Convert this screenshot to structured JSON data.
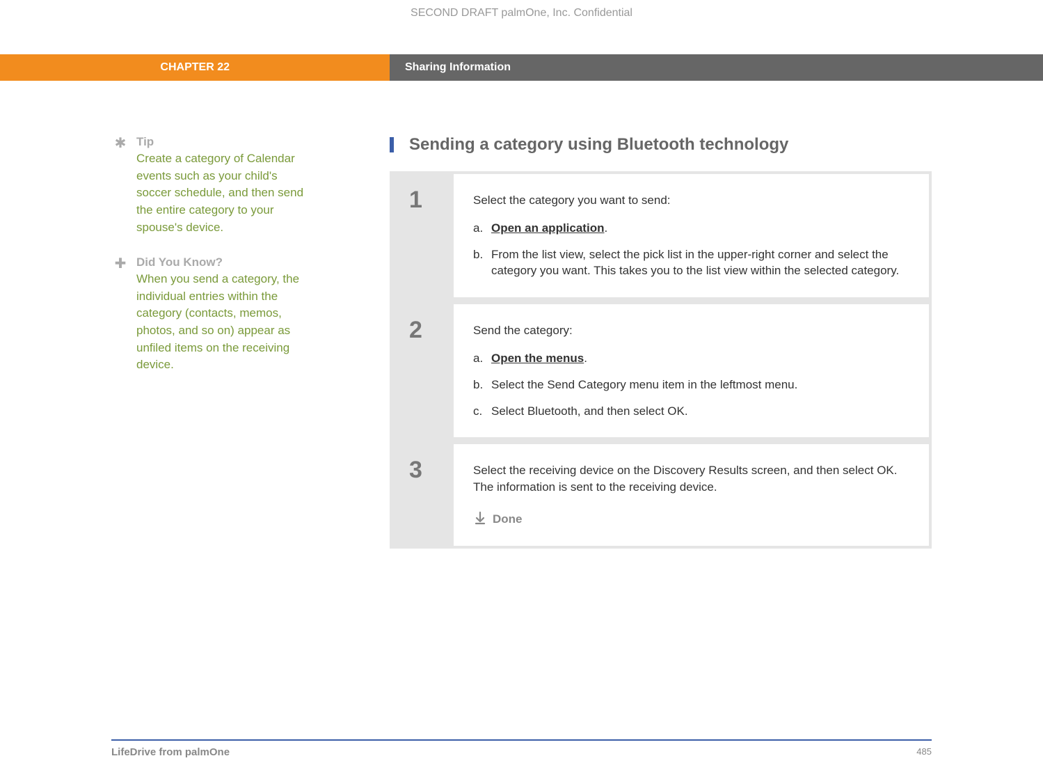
{
  "draft_header": "SECOND DRAFT palmOne, Inc.  Confidential",
  "chapter_label": "CHAPTER 22",
  "chapter_title": "Sharing Information",
  "sidebar": {
    "tip": {
      "heading": "Tip",
      "text": "Create a category of Calendar events such as your child's soccer schedule, and then send the entire category to your spouse's device."
    },
    "dyk": {
      "heading": "Did You Know?",
      "text": "When you send a category, the individual entries within the category (contacts, memos, photos, and so on) appear as unfiled items on the receiving device."
    }
  },
  "section_heading": "Sending a category using Bluetooth technology",
  "steps": [
    {
      "number": "1",
      "intro": "Select the category you want to send:",
      "items": [
        {
          "letter": "a.",
          "link": "Open an application",
          "after_link": "."
        },
        {
          "letter": "b.",
          "text": "From the list view, select the pick list in the upper-right corner and select the category you want. This takes you to the list view within the selected category."
        }
      ]
    },
    {
      "number": "2",
      "intro": "Send the category:",
      "items": [
        {
          "letter": "a.",
          "link": "Open the menus",
          "after_link": "."
        },
        {
          "letter": "b.",
          "text": "Select the Send Category menu item in the leftmost menu."
        },
        {
          "letter": "c.",
          "text": "Select Bluetooth, and then select OK."
        }
      ]
    },
    {
      "number": "3",
      "intro": "Select the receiving device on the Discovery Results screen, and then select OK. The information is sent to the receiving device.",
      "done_label": "Done"
    }
  ],
  "footer": {
    "left": "LifeDrive from palmOne",
    "right": "485"
  }
}
